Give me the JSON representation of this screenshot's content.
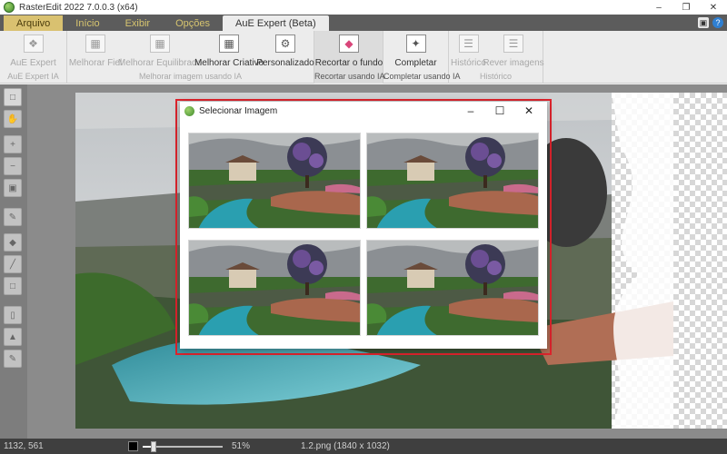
{
  "window": {
    "title": "RasterEdit 2022 7.0.0.3 (x64)",
    "controls": [
      "–",
      "❐",
      "✕"
    ]
  },
  "ribbon_tabs": [
    {
      "label": "Arquivo",
      "state": "file"
    },
    {
      "label": "Início",
      "state": "normal"
    },
    {
      "label": "Exibir",
      "state": "normal"
    },
    {
      "label": "Opções",
      "state": "normal"
    },
    {
      "label": "AuE Expert (Beta)",
      "state": "active"
    }
  ],
  "quick_access": {
    "save_icon": "save-icon",
    "help_label": "?"
  },
  "ribbon_groups": [
    {
      "name": "AuE Expert IA",
      "enabled": false,
      "buttons": [
        {
          "label": "AuE Expert",
          "icon": "expert-icon",
          "enabled": false
        }
      ]
    },
    {
      "name": "Melhorar imagem usando IA",
      "enabled": false,
      "buttons": [
        {
          "label": "Melhorar Fiel",
          "icon": "image-icon",
          "enabled": false
        },
        {
          "label": "Melhorar Equilibrado",
          "icon": "image-icon",
          "enabled": false
        },
        {
          "label": "Melhorar Criativo",
          "icon": "image-icon",
          "enabled": true
        },
        {
          "label": "Personalizado",
          "icon": "settings-image-icon",
          "enabled": true
        }
      ]
    },
    {
      "name": "Recortar usando IA",
      "enabled": true,
      "selected": true,
      "buttons": [
        {
          "label": "Recortar o fundo",
          "icon": "eraser-icon",
          "enabled": true
        }
      ]
    },
    {
      "name": "Completar usando IA",
      "enabled": true,
      "buttons": [
        {
          "label": "Completar",
          "icon": "magic-wand-icon",
          "enabled": true
        }
      ]
    },
    {
      "name": "Histórico",
      "enabled": false,
      "buttons": [
        {
          "label": "Histórico",
          "icon": "history-icon",
          "enabled": false
        },
        {
          "label": "Rever imagens",
          "icon": "review-icon",
          "enabled": false
        }
      ]
    }
  ],
  "tools": [
    "select-tool-icon",
    "hand-icon",
    "zoom-in-icon",
    "zoom-out-icon",
    "fit-screen-icon",
    "eyedropper-icon",
    "eraser-tool-icon",
    "ruler-icon",
    "crop-icon",
    "perspective-icon",
    "stamp-icon",
    "magic-pen-icon"
  ],
  "dialog": {
    "title": "Selecionar Imagem",
    "controls": [
      "–",
      "☐",
      "✕"
    ],
    "thumbnail_count": 4
  },
  "status": {
    "coords": "1132, 561",
    "zoom_label": "51%",
    "zoom_level": 0.51,
    "file_info": "1.2.png (1840 x 1032)"
  },
  "colors": {
    "accent_highlight": "#e0242d",
    "tab_gold": "#d9c170",
    "ribbon_bg": "#ececec"
  }
}
